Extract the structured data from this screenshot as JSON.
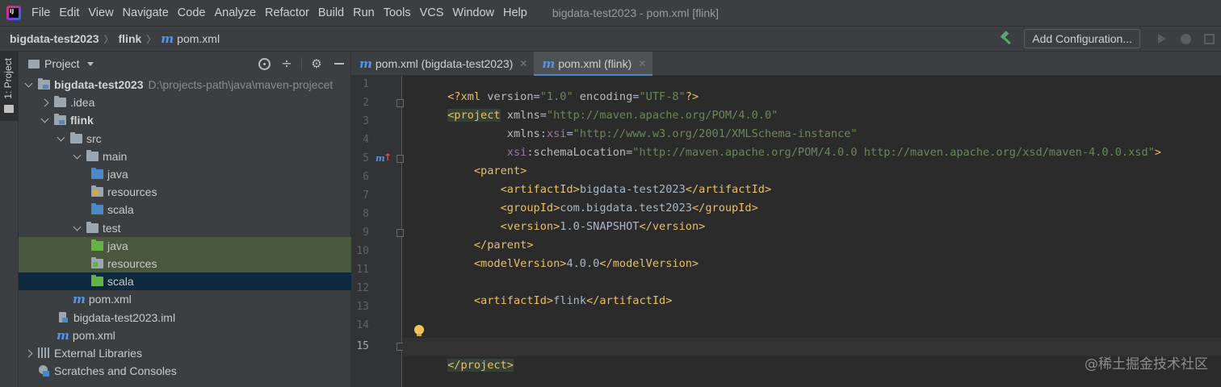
{
  "menubar": {
    "app_icon": "intellij-idea-icon",
    "items": [
      "File",
      "Edit",
      "View",
      "Navigate",
      "Code",
      "Analyze",
      "Refactor",
      "Build",
      "Run",
      "Tools",
      "VCS",
      "Window",
      "Help"
    ],
    "window_title": "bigdata-test2023 - pom.xml [flink]"
  },
  "navbar": {
    "crumbs": [
      "bigdata-test2023",
      "flink",
      "pom.xml"
    ],
    "add_configuration_label": "Add Configuration...",
    "icons": [
      "hammer-icon",
      "run-icon",
      "debug-icon",
      "coverage-icon"
    ]
  },
  "left_strip": {
    "tab_label": "1: Project"
  },
  "project_panel": {
    "title": "Project",
    "tree": [
      {
        "label": "bigdata-test2023",
        "path": "D:\\projects-path\\java\\maven-projecet",
        "bold": true
      },
      {
        "label": ".idea"
      },
      {
        "label": "flink",
        "bold": true
      },
      {
        "label": "src"
      },
      {
        "label": "main"
      },
      {
        "label": "java"
      },
      {
        "label": "resources"
      },
      {
        "label": "scala"
      },
      {
        "label": "test"
      },
      {
        "label": "java"
      },
      {
        "label": "resources"
      },
      {
        "label": "scala"
      },
      {
        "label": "pom.xml"
      },
      {
        "label": "bigdata-test2023.iml"
      },
      {
        "label": "pom.xml"
      },
      {
        "label": "External Libraries"
      },
      {
        "label": "Scratches and Consoles"
      }
    ]
  },
  "editor_tabs": [
    {
      "label": "pom.xml (bigdata-test2023)",
      "active": false
    },
    {
      "label": "pom.xml (flink)",
      "active": true
    }
  ],
  "editor": {
    "line_numbers": [
      "1",
      "2",
      "3",
      "4",
      "5",
      "6",
      "7",
      "8",
      "9",
      "10",
      "11",
      "12",
      "13",
      "14",
      "15"
    ],
    "current_line": 15,
    "lines": [
      {
        "pi_open": "<?xml ",
        "a1": "version",
        "eq1": "=",
        "v1": "\"1.0\"",
        "a2": " encoding",
        "eq2": "=",
        "v2": "\"UTF-8\"",
        "pi_close": "?>"
      },
      {
        "tag_open": "<project",
        "attr": " xmlns",
        "eq": "=",
        "val": "\"http://maven.apache.org/POM/4.0.0\""
      },
      {
        "indent": "         ",
        "attr": "xmlns",
        "colon": ":",
        "ns": "xsi",
        "eq": "=",
        "val": "\"http://www.w3.org/2001/XMLSchema-instance\""
      },
      {
        "indent": "         ",
        "ns": "xsi",
        "colon": ":",
        "attr": "schemaLocation",
        "eq": "=",
        "val": "\"http://maven.apache.org/POM/4.0.0 http://maven.apache.org/xsd/maven-4.0.0.xsd\"",
        "close": ">"
      },
      {
        "indent": "    ",
        "tag": "<parent>"
      },
      {
        "indent": "        ",
        "open": "<artifactId>",
        "text": "bigdata-test2023",
        "close": "</artifactId>"
      },
      {
        "indent": "        ",
        "open": "<groupId>",
        "text": "com.bigdata.test2023",
        "close": "</groupId>"
      },
      {
        "indent": "        ",
        "open": "<version>",
        "text": "1.0-SNAPSHOT",
        "close": "</version>"
      },
      {
        "indent": "    ",
        "tag": "</parent>"
      },
      {
        "indent": "    ",
        "open": "<modelVersion>",
        "text": "4.0.0",
        "close": "</modelVersion>"
      },
      {
        "empty": ""
      },
      {
        "indent": "    ",
        "open": "<artifactId>",
        "text": "flink",
        "close": "</artifactId>"
      },
      {
        "empty": ""
      },
      {
        "empty": ""
      },
      {
        "tag": "</project>"
      }
    ]
  },
  "watermark": "@稀土掘金技术社区",
  "colors": {
    "background": "#2b2b2b",
    "panel": "#3c3f41",
    "selection": "#0d293e",
    "test_highlight": "#48573e",
    "xml_tag": "#e8bf6a",
    "xml_string": "#6a8759",
    "xml_namespace": "#9876aa",
    "accent": "#4a88c7"
  }
}
